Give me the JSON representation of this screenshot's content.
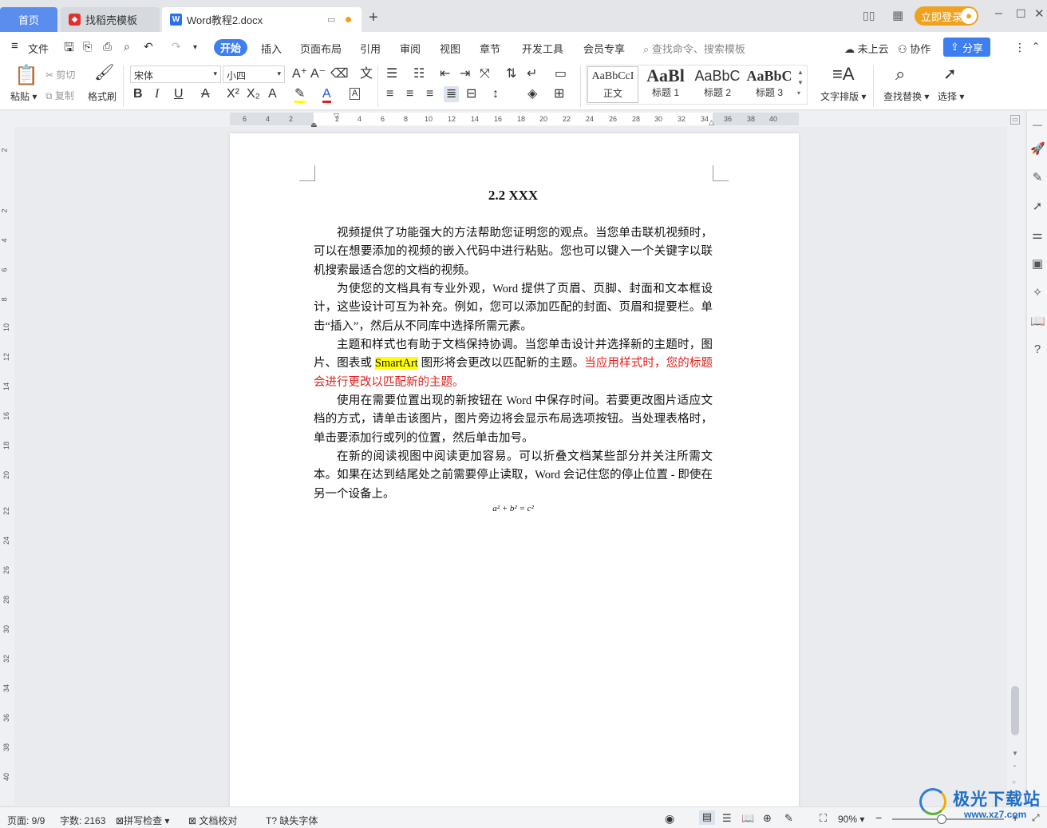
{
  "tabs": {
    "home": "首页",
    "template": "找稻壳模板",
    "doc": "Word教程2.docx",
    "add": "+"
  },
  "titlebar": {
    "login": "立即登录"
  },
  "menu": {
    "file": "文件",
    "items": [
      "开始",
      "插入",
      "页面布局",
      "引用",
      "审阅",
      "视图",
      "章节",
      "开发工具",
      "会员专享"
    ],
    "search": "查找命令、搜索模板",
    "cloud": "未上云",
    "collab": "协作",
    "share": "分享"
  },
  "ribbon": {
    "paste": "粘贴",
    "cut": "剪切",
    "copy": "复制",
    "format_painter": "格式刷",
    "font": "宋体",
    "size": "小四",
    "styles": [
      {
        "preview": "AaBbCcI",
        "label": "正文"
      },
      {
        "preview": "AaBl",
        "label": "标题 1"
      },
      {
        "preview": "AaBbC",
        "label": "标题 2"
      },
      {
        "preview": "AaBbC",
        "label": "标题 3"
      }
    ],
    "text_layout": "文字排版",
    "find_replace": "查找替换",
    "select": "选择"
  },
  "ruler": {
    "h": [
      "6",
      "4",
      "2",
      "2",
      "4",
      "6",
      "8",
      "10",
      "12",
      "14",
      "16",
      "18",
      "20",
      "22",
      "24",
      "26",
      "28",
      "30",
      "32",
      "34",
      "36",
      "38",
      "40"
    ],
    "v": [
      "2",
      "2",
      "4",
      "6",
      "8",
      "10",
      "12",
      "14",
      "16",
      "18",
      "20",
      "22",
      "24",
      "26",
      "28",
      "30",
      "32",
      "34",
      "36",
      "38",
      "40"
    ]
  },
  "document": {
    "heading": "2.2 XXX",
    "p1": "视频提供了功能强大的方法帮助您证明您的观点。当您单击联机视频时，可以在想要添加的视频的嵌入代码中进行粘贴。您也可以键入一个关键字以联机搜索最适合您的文档的视频。",
    "p2": "为使您的文档具有专业外观，Word 提供了页眉、页脚、封面和文本框设计，这些设计可互为补充。例如，您可以添加匹配的封面、页眉和提要栏。单击“插入”，然后从不同库中选择所需元素。",
    "p3a": "主题和样式也有助于文档保持协调。当您单击设计并选择新的主题时，图片、图表或 ",
    "p3hl": "SmartArt",
    "p3b": " 图形将会更改以匹配新的主题。",
    "p3red": "当应用样式时，您的标题会进行更改以匹配新的主题。",
    "p4": "使用在需要位置出现的新按钮在 Word 中保存时间。若要更改图片适应文档的方式，请单击该图片，图片旁边将会显示布局选项按钮。当处理表格时，单击要添加行或列的位置，然后单击加号。",
    "p5": "在新的阅读视图中阅读更加容易。可以折叠文档某些部分并关注所需文本。如果在达到结尾处之前需要停止读取，Word 会记住您的停止位置 - 即使在另一个设备上。",
    "formula": "a² + b² = c²"
  },
  "status": {
    "page": "页面: 9/9",
    "words": "字数: 2163",
    "spell": "拼写检查",
    "proof": "文档校对",
    "missing_font": "缺失字体",
    "zoom": "90%"
  },
  "watermark": {
    "name": "极光下载站",
    "url": "www.xz7.com"
  },
  "colors": {
    "accent": "#3d7ff1",
    "active_tab": "#5b8dee",
    "highlight": "#ffff00",
    "red_text": "#e0201c"
  }
}
